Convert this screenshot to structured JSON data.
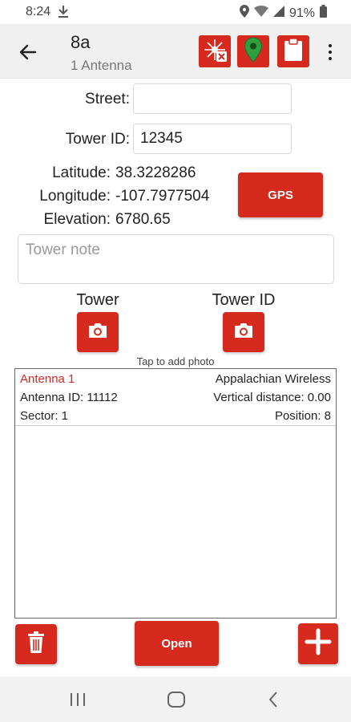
{
  "status_bar": {
    "time": "8:24",
    "battery": "91%"
  },
  "app_bar": {
    "title": "8a",
    "subtitle": "1 Antenna",
    "icons": [
      "back-arrow-icon",
      "laser-off-icon",
      "map-pin-icon",
      "clipboard-icon",
      "overflow-menu-icon"
    ]
  },
  "form": {
    "street_label": "Street:",
    "street_value": "",
    "tower_id_label": "Tower ID:",
    "tower_id_value": "12345",
    "latitude_label": "Latitude:",
    "latitude_value": "38.3228286",
    "longitude_label": "Longitude:",
    "longitude_value": "-107.7977504",
    "elevation_label": "Elevation:",
    "elevation_value": "6780.65",
    "gps_button": "GPS",
    "note_placeholder": "Tower note"
  },
  "photos": {
    "tower_label": "Tower",
    "tower_id_label": "Tower ID",
    "hint": "Tap to add photo"
  },
  "antennas": [
    {
      "name": "Antenna 1",
      "carrier": "Appalachian Wireless",
      "antenna_id": "Antenna ID: 11112",
      "vertical_distance": "Vertical distance: 0.00",
      "sector": "Sector: 1",
      "position": "Position: 8"
    }
  ],
  "actions": {
    "open_label": "Open"
  },
  "colors": {
    "accent": "#d62a1f",
    "appbar_bg": "#f0f0f0",
    "pin_green": "#2e9e3e"
  }
}
